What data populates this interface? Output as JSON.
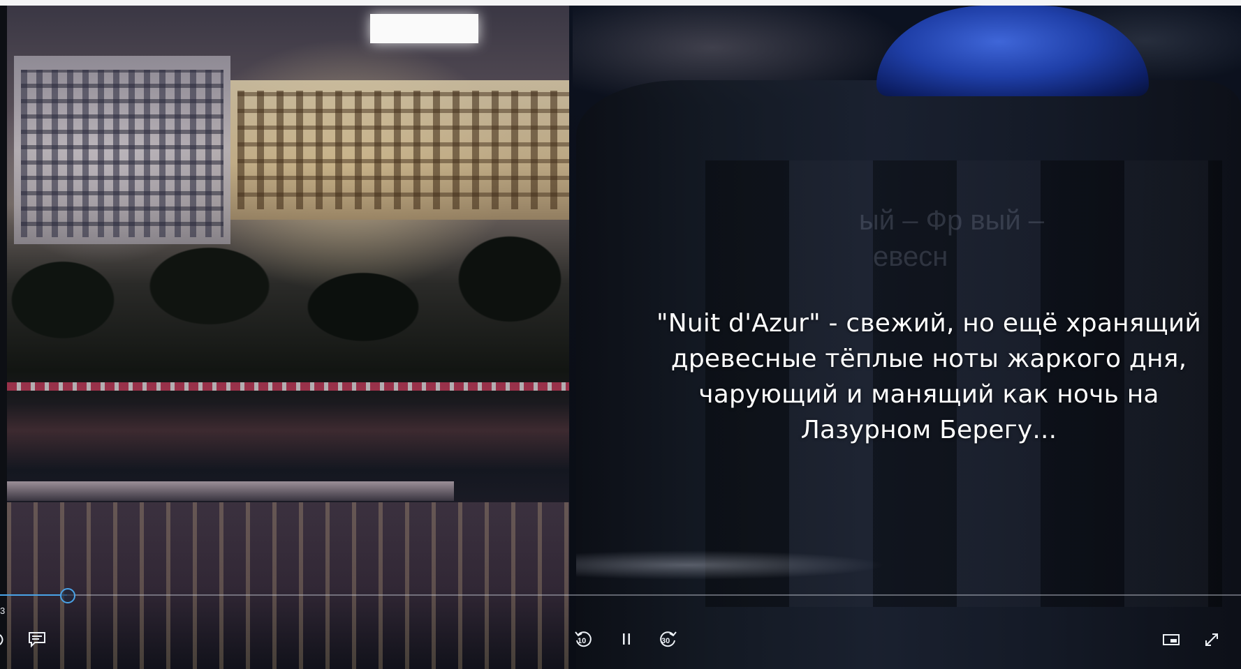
{
  "slide": {
    "caption": "\"Nuit d'Azur\" - свежий, но ещё хранящий древесные тёплые ноты жаркого дня, чарующий и манящий как ночь на Лазурном Берегу...",
    "background_text_line1": "ый – Фр        вый –",
    "background_text_line2": "евесн"
  },
  "player": {
    "elapsed_time": "3",
    "progress_fraction": 0.054,
    "skip_back_seconds": "10",
    "skip_forward_seconds": "30",
    "accent_color": "#4aa3e8",
    "icons": {
      "captions": "captions-icon",
      "skip_back": "rewind-10-icon",
      "pause": "pause-icon",
      "skip_forward": "forward-30-icon",
      "mini_view": "mini-view-icon",
      "fullscreen": "fullscreen-icon"
    }
  }
}
